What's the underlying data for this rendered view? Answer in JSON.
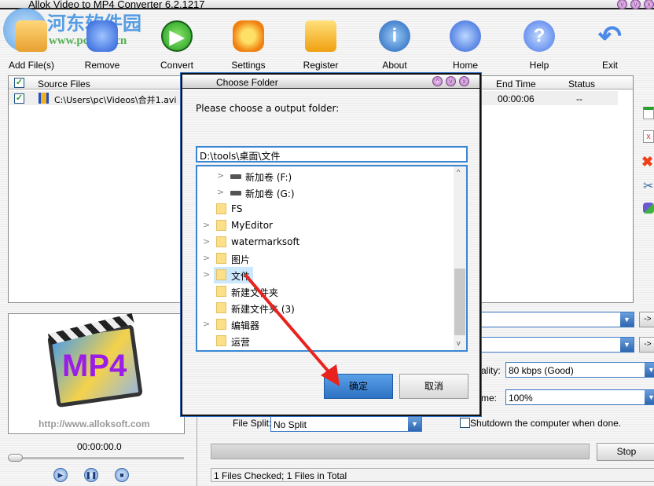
{
  "window": {
    "title": "Allok Video to MP4 Converter 6.2.1217"
  },
  "watermark": {
    "name": "河东软件园",
    "url": "www.pc0359.cn"
  },
  "toolbar": [
    {
      "label": "Add File(s)",
      "icon": "add-files-icon"
    },
    {
      "label": "Remove",
      "icon": "trash-icon"
    },
    {
      "label": "Convert",
      "icon": "play-icon"
    },
    {
      "label": "Settings",
      "icon": "gear-icon"
    },
    {
      "label": "Register",
      "icon": "lock-icon"
    },
    {
      "label": "About",
      "icon": "info-icon"
    },
    {
      "label": "Home",
      "icon": "globe-icon"
    },
    {
      "label": "Help",
      "icon": "help-icon"
    },
    {
      "label": "Exit",
      "icon": "back-arrow-icon"
    }
  ],
  "file_list": {
    "columns": [
      "Source Files",
      "End Time",
      "Status"
    ],
    "rows": [
      {
        "checked": true,
        "source": "C:\\Users\\pc\\Videos\\合并1.avi",
        "end_time": "00:00:06",
        "status": "--"
      }
    ]
  },
  "preview": {
    "logo_text": "MP4",
    "url": "http://www.alloksoft.com",
    "time": "00:00:00.0"
  },
  "settings": {
    "quality_label": "ality:",
    "quality_value": "80  kbps (Good)",
    "volume_label": "me:",
    "volume_value": "100%",
    "file_split_label": "File Split:",
    "file_split_value": "No Split",
    "shutdown_label": "Shutdown the computer when done.",
    "shutdown_checked": false,
    "arrow_button": "->"
  },
  "progress": {
    "percent": 0
  },
  "stop_label": "Stop",
  "status_bar": "1 Files Checked; 1 Files in Total",
  "dialog": {
    "title": "Choose Folder",
    "prompt": "Please choose a output folder:",
    "path": "D:\\tools\\桌面\\文件",
    "tree": [
      {
        "name": "新加卷 (F:)",
        "type": "drive",
        "expandable": true
      },
      {
        "name": "新加卷 (G:)",
        "type": "drive",
        "expandable": true
      },
      {
        "name": "FS",
        "type": "folder",
        "expandable": false
      },
      {
        "name": "MyEditor",
        "type": "folder",
        "expandable": true
      },
      {
        "name": "watermarksoft",
        "type": "folder",
        "expandable": true
      },
      {
        "name": "图片",
        "type": "folder",
        "expandable": true
      },
      {
        "name": "文件",
        "type": "folder",
        "expandable": true,
        "selected": true
      },
      {
        "name": "新建文件夹",
        "type": "folder",
        "expandable": false
      },
      {
        "name": "新建文件夹 (3)",
        "type": "folder",
        "expandable": false
      },
      {
        "name": "编辑器",
        "type": "folder",
        "expandable": true
      },
      {
        "name": "运营",
        "type": "folder",
        "expandable": false
      }
    ],
    "ok_label": "确定",
    "cancel_label": "取消"
  },
  "colors": {
    "accent": "#3a78c4",
    "selection": "#cce8ff",
    "annotation_arrow": "#e8231e",
    "logo_text": "#9a1ee6"
  }
}
